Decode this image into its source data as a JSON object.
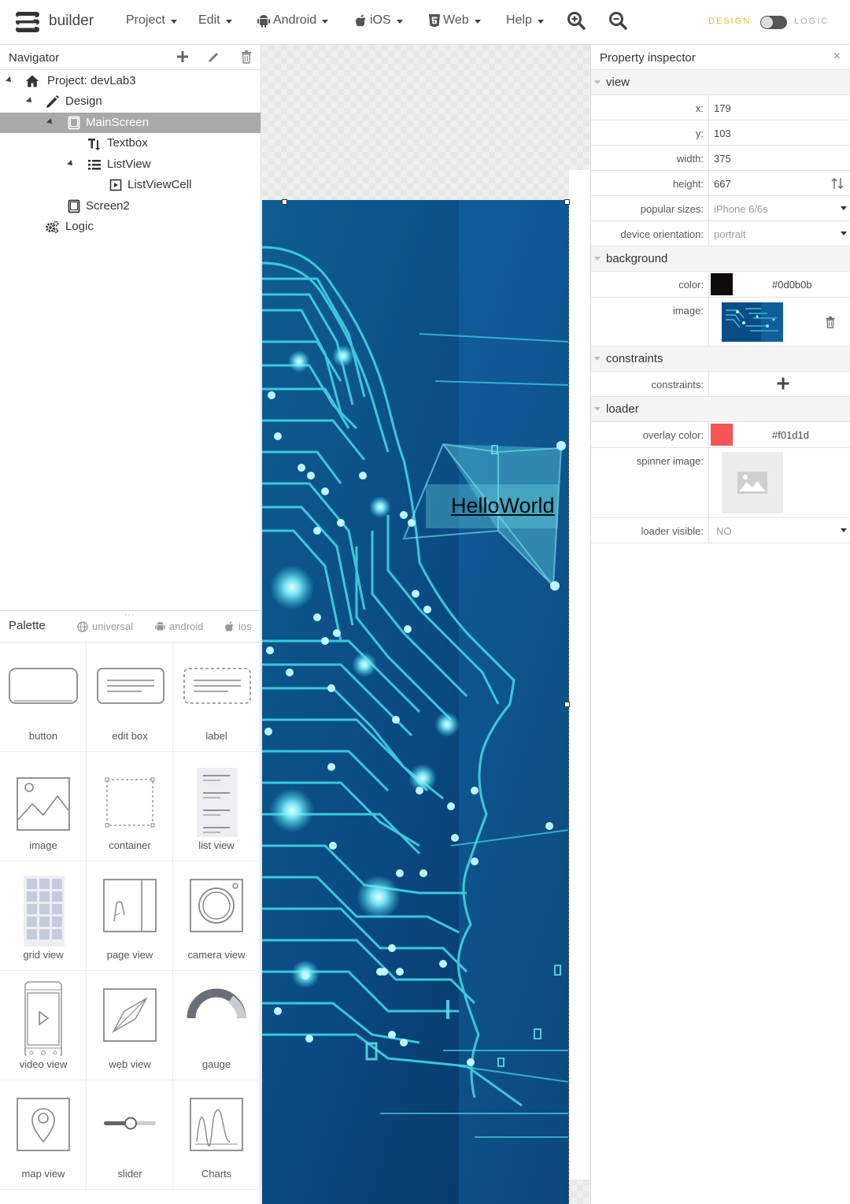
{
  "app": {
    "brand": "builder"
  },
  "menu": {
    "project": "Project",
    "edit": "Edit",
    "android": "Android",
    "ios": "iOS",
    "web": "Web",
    "help": "Help"
  },
  "mode": {
    "design": "DESIGN",
    "logic": "LOGIC",
    "active": "design"
  },
  "navigator": {
    "title": "Navigator",
    "tree": [
      {
        "label": "Project: devLab3",
        "icon": "home-icon"
      },
      {
        "label": "Design",
        "icon": "pencil-icon"
      },
      {
        "label": "MainScreen",
        "icon": "tablet-icon",
        "selected": true
      },
      {
        "label": "Textbox",
        "icon": "text-icon"
      },
      {
        "label": "ListView",
        "icon": "list-icon"
      },
      {
        "label": "ListViewCell",
        "icon": "cell-icon"
      },
      {
        "label": "Screen2",
        "icon": "tablet-icon"
      },
      {
        "label": "Logic",
        "icon": "gears-icon"
      }
    ]
  },
  "palette": {
    "title": "Palette",
    "tabs": [
      "universal",
      "android",
      "ios"
    ],
    "items": [
      {
        "label": "button"
      },
      {
        "label": "edit box"
      },
      {
        "label": "label"
      },
      {
        "label": "image"
      },
      {
        "label": "container"
      },
      {
        "label": "list view"
      },
      {
        "label": "grid view"
      },
      {
        "label": "page view"
      },
      {
        "label": "camera view"
      },
      {
        "label": "video view"
      },
      {
        "label": "web view"
      },
      {
        "label": "gauge"
      },
      {
        "label": "map view"
      },
      {
        "label": "slider"
      },
      {
        "label": "Charts"
      }
    ]
  },
  "canvas": {
    "hello_text": "HelloWorld"
  },
  "inspector": {
    "title": "Property inspector",
    "close": "×",
    "sections": {
      "view": "view",
      "background": "background",
      "constraints": "constraints",
      "loader": "loader"
    },
    "view": {
      "x": {
        "label": "x:",
        "value": "179"
      },
      "y": {
        "label": "y:",
        "value": "103"
      },
      "width": {
        "label": "width:",
        "value": "375"
      },
      "height": {
        "label": "height:",
        "value": "667"
      },
      "popular_sizes": {
        "label": "popular sizes:",
        "value": "iPhone 6/6s"
      },
      "orientation": {
        "label": "device orientation:",
        "value": "portrait"
      }
    },
    "background": {
      "color": {
        "label": "color:",
        "value": "#0d0b0b",
        "swatch": "#0d0b0b"
      },
      "image": {
        "label": "image:"
      }
    },
    "constraints": {
      "label": "constraints:"
    },
    "loader": {
      "overlay": {
        "label": "overlay color:",
        "value": "#f01d1d",
        "swatch": "#f01d1d"
      },
      "spinner": {
        "label": "spinner image:"
      },
      "visible": {
        "label": "loader visible:",
        "value": "NO"
      }
    }
  },
  "colors": {
    "accent": "#f0b429",
    "selection": "#a9a9a9",
    "screen_bg": "#0a3f72",
    "circuit": "#3fd6e6"
  }
}
